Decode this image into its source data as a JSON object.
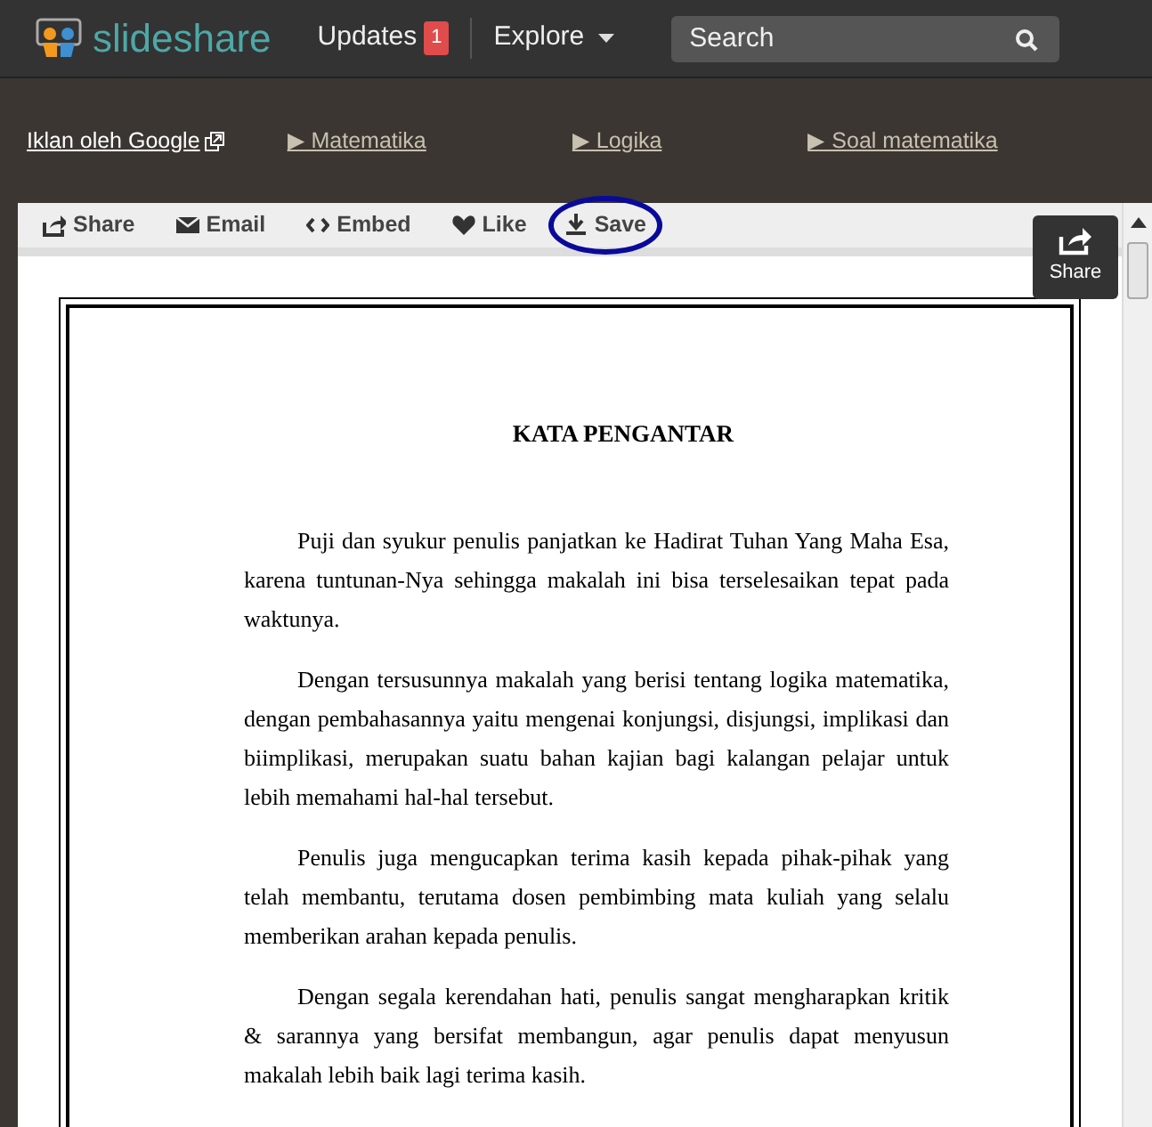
{
  "header": {
    "logo_text": "slideshare",
    "nav": [
      {
        "label": "Updates",
        "badge": "1"
      },
      {
        "label": "Explore",
        "caret": true
      }
    ],
    "search": {
      "placeholder": "Search"
    }
  },
  "ad_bar": {
    "label": "Iklan oleh Google",
    "links": [
      "▶ Matematika",
      "▶ Logika",
      "▶ Soal matematika"
    ]
  },
  "toolbar": [
    {
      "kind": "share",
      "label": "Share",
      "highlighted": false
    },
    {
      "kind": "email",
      "label": "Email",
      "highlighted": false
    },
    {
      "kind": "embed",
      "label": "Embed",
      "highlighted": false
    },
    {
      "kind": "like",
      "label": "Like",
      "highlighted": false
    },
    {
      "kind": "save",
      "label": "Save",
      "highlighted": true
    }
  ],
  "share_button": {
    "label": "Share"
  },
  "document": {
    "title": "KATA PENGANTAR",
    "paragraphs": [
      "Puji dan syukur penulis panjatkan ke Hadirat Tuhan Yang Maha Esa, karena tuntunan-Nya sehingga makalah ini bisa terselesaikan tepat pada waktunya.",
      "Dengan tersusunnya makalah yang berisi tentang logika matematika, dengan pembahasannya yaitu mengenai konjungsi, disjungsi, implikasi dan biimplikasi, merupakan suatu bahan kajian bagi kalangan pelajar untuk lebih memahami hal-hal tersebut.",
      "Penulis juga mengucapkan terima kasih kepada pihak-pihak yang telah membantu, terutama dosen pembimbing mata kuliah yang selalu memberikan arahan kepada penulis.",
      "Dengan segala kerendahan hati, penulis sangat mengharapkan kritik & sarannya yang bersifat membangun, agar penulis dapat menyusun makalah lebih baik lagi terima kasih."
    ]
  }
}
